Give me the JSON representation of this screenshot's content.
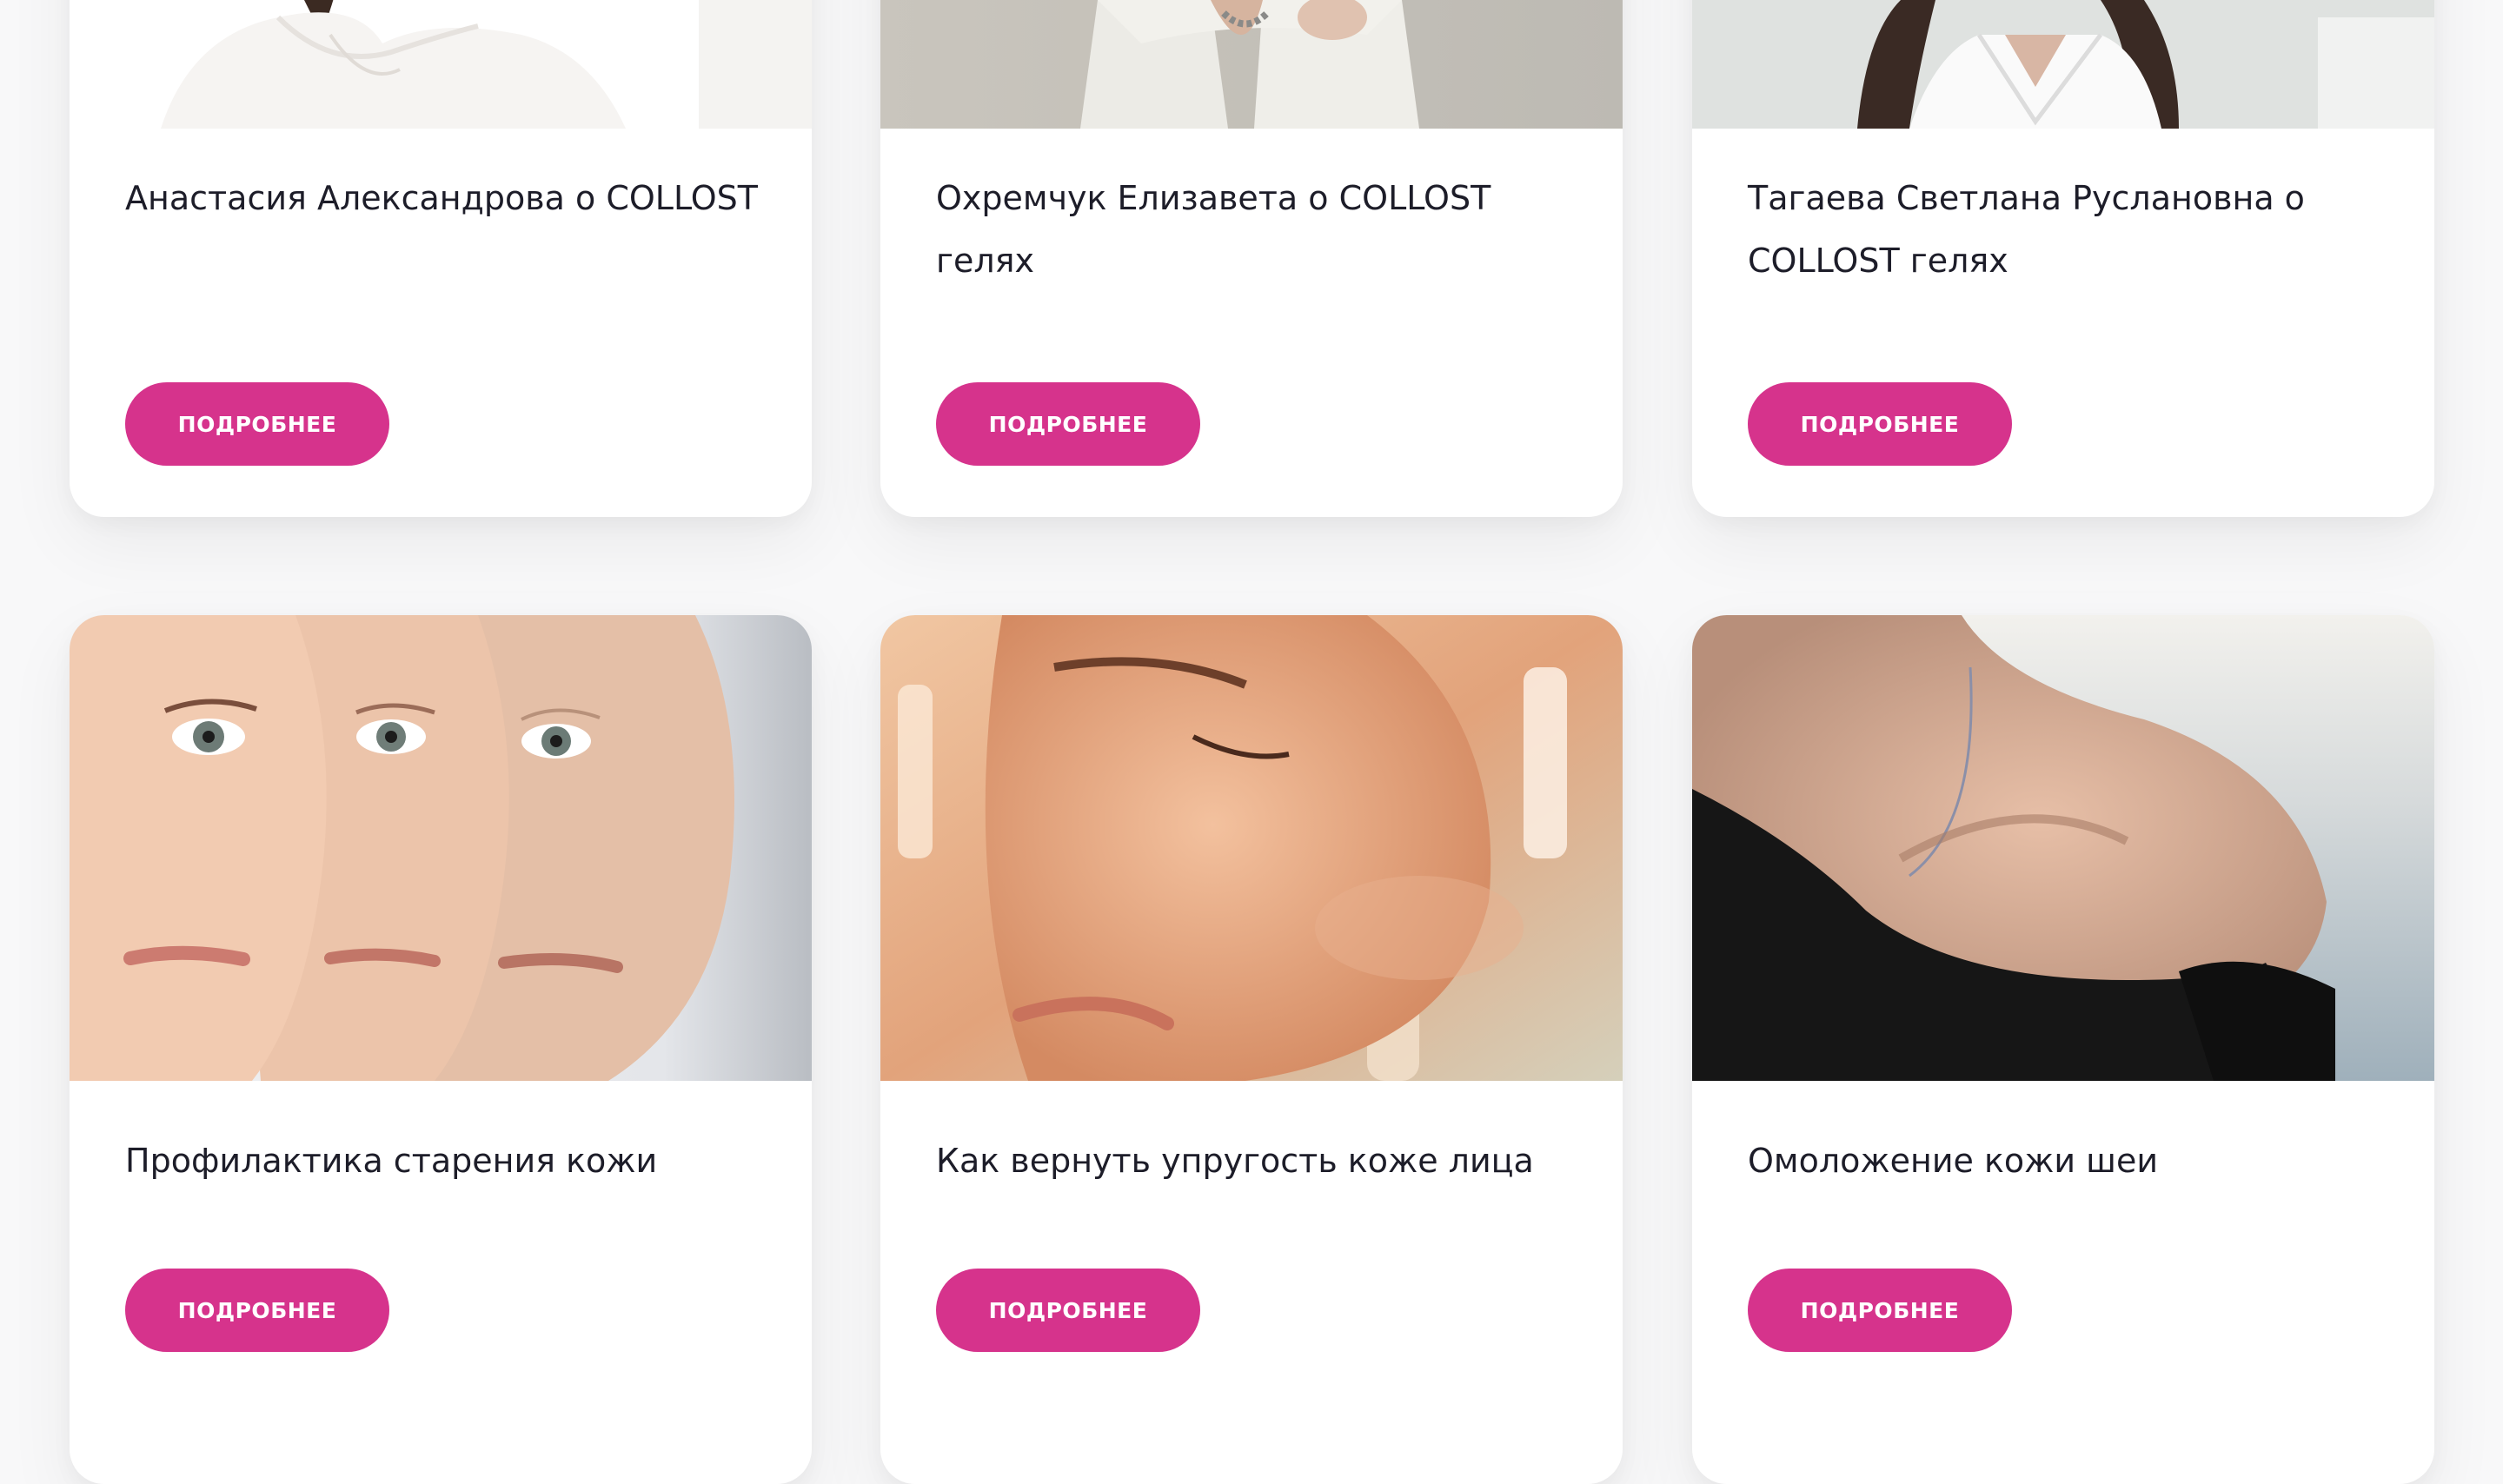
{
  "cards": [
    {
      "title": "Анастасия Александрова о COLLOST",
      "button": "ПОДРОБНЕЕ",
      "image": "portrait-woman-white-top"
    },
    {
      "title": "Охремчук Елизавета о COLLOST гелях",
      "button": "ПОДРОБНЕЕ",
      "image": "portrait-woman-white-blazer"
    },
    {
      "title": "Тагаева Светлана Руслановна о COLLOST гелях",
      "button": "ПОДРОБНЕЕ",
      "image": "portrait-woman-dark-hair"
    },
    {
      "title": "Профилактика старения кожи",
      "button": "ПОДРОБНЕЕ",
      "image": "aging-faces"
    },
    {
      "title": "Как вернуть упругость коже лица",
      "button": "ПОДРОБНЕЕ",
      "image": "woman-face-relaxing"
    },
    {
      "title": "Омоложение кожи шеи",
      "button": "ПОДРОБНЕЕ",
      "image": "woman-neck-shoulder"
    }
  ],
  "colors": {
    "accent": "#d6338c",
    "title": "#1d1d29",
    "background": "#f8f8f9"
  }
}
